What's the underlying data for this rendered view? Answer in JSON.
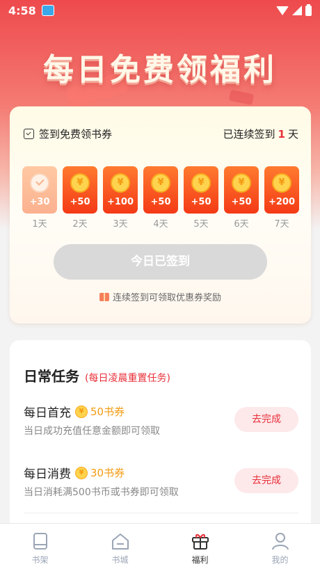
{
  "status_bar": {
    "time": "4:58"
  },
  "hero": {
    "title": "每日免费领福利"
  },
  "signin": {
    "header_label": "签到免费领书券",
    "streak_prefix": "已连续签到",
    "streak_days": "1",
    "streak_suffix": "天",
    "days": [
      {
        "amount": "+30",
        "label": "1天",
        "checked": true
      },
      {
        "amount": "+50",
        "label": "2天",
        "checked": false
      },
      {
        "amount": "+100",
        "label": "3天",
        "checked": false
      },
      {
        "amount": "+50",
        "label": "4天",
        "checked": false
      },
      {
        "amount": "+50",
        "label": "5天",
        "checked": false
      },
      {
        "amount": "+50",
        "label": "6天",
        "checked": false
      },
      {
        "amount": "+200",
        "label": "7天",
        "checked": false
      }
    ],
    "coin_symbol": "¥",
    "button_label": "今日已签到",
    "tip": "连续签到可领取优惠券奖励"
  },
  "tasks": {
    "title": "日常任务",
    "subtitle": "(每日凌晨重置任务)",
    "items": [
      {
        "name": "每日首充",
        "reward": "50书券",
        "desc": "当日成功充值任意金额即可领取",
        "button": "去完成"
      },
      {
        "name": "每日消费",
        "reward": "30书券",
        "desc": "当日消耗满500书币或书券即可领取",
        "button": "去完成"
      }
    ]
  },
  "bottom_nav": {
    "items": [
      {
        "label": "书架",
        "icon": "bookshelf-icon",
        "active": false
      },
      {
        "label": "书城",
        "icon": "bookstore-icon",
        "active": false
      },
      {
        "label": "福利",
        "icon": "gift-icon",
        "active": true
      },
      {
        "label": "我的",
        "icon": "profile-icon",
        "active": false
      }
    ]
  },
  "colors": {
    "accent_red": "#e8303a",
    "coin_orange": "#f43a16",
    "reward_gold": "#f39b12"
  }
}
